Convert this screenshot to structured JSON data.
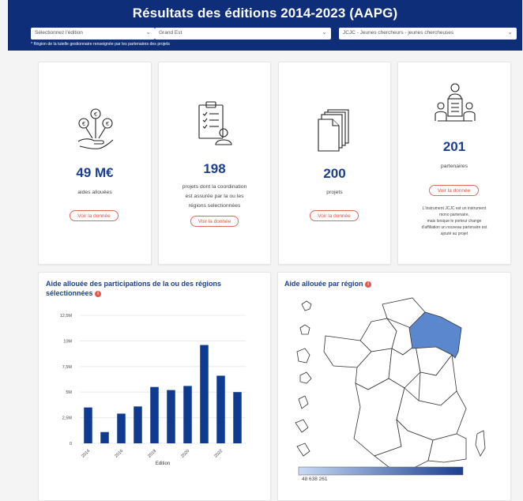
{
  "header": {
    "title": "Résultats des éditions 2014-2023 (AAPG)",
    "select_edition": "Sélectionnez l'édition",
    "select_region": "Grand Est",
    "select_instrument": "JCJC - Jeunes chercheurs - jeunes chercheuses",
    "note": "* Région de la tutelle gestionnaire renseignée par les partenaires des projets"
  },
  "cards": [
    {
      "icon": "money-hand-icon",
      "value": "49 M€",
      "desc": "aides allouées",
      "button": "Voir la donnée"
    },
    {
      "icon": "coordination-clipboard-icon",
      "value": "198",
      "desc_lines": [
        "projets dont la coordination",
        "est assurée par la ou les",
        "régions selectionnées"
      ],
      "button": "Voir la donnée"
    },
    {
      "icon": "projects-stack-icon",
      "value": "200",
      "desc": "projets",
      "button": "Voir la donnée"
    },
    {
      "icon": "partners-meeting-icon",
      "value": "201",
      "desc": "partenaires",
      "button": "Voir la donnée",
      "note_lines": [
        "L'instrument JCJC est un instrument",
        "mono partenaire,",
        "mais lorsque le porteur change",
        "d'affiliation un nouveau partenaire est",
        "ajouté au projet"
      ]
    }
  ],
  "bar_panel": {
    "title_line1": "Aide allouée des participations de la ou des régions",
    "title_line2": "sélectionnées",
    "info_icon": "info-icon"
  },
  "map_panel": {
    "title": "Aide allouée par région",
    "info_icon": "info-icon",
    "legend_value": "48 638 261",
    "highlight_color": "#5b87cf",
    "scale_colors": [
      "#c9daf5",
      "#1b3f8f"
    ]
  },
  "chart_data": {
    "type": "bar",
    "title": "Aide allouée des participations de la ou des régions sélectionnées",
    "xlabel": "Edition",
    "ylabel": "",
    "categories": [
      "2014",
      "2015",
      "2016",
      "2017",
      "2018",
      "2019",
      "2020",
      "2021",
      "2022",
      "2023"
    ],
    "values": [
      3.5,
      1.1,
      2.9,
      3.6,
      5.5,
      5.2,
      5.6,
      9.6,
      6.6,
      5.0
    ],
    "unit": "M",
    "ylim": [
      0,
      12.5
    ],
    "yticks": [
      "0",
      "2,5M",
      "5M",
      "7,5M",
      "10M",
      "12,5M"
    ],
    "xtick_labels": [
      "2014",
      "2016",
      "2018",
      "2020",
      "2022"
    ],
    "bar_color": "#0e3a8f",
    "grid": true
  }
}
